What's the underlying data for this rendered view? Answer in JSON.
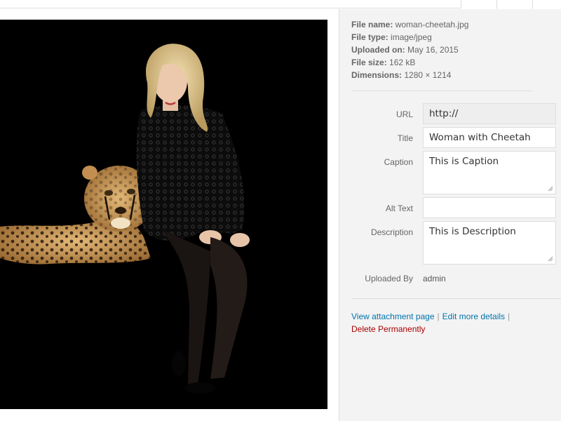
{
  "details": {
    "file_name_label": "File name:",
    "file_name": "woman-cheetah.jpg",
    "file_type_label": "File type:",
    "file_type": "image/jpeg",
    "uploaded_on_label": "Uploaded on:",
    "uploaded_on": "May 16, 2015",
    "file_size_label": "File size:",
    "file_size": "162 kB",
    "dimensions_label": "Dimensions:",
    "dimensions": "1280 × 1214"
  },
  "fields": {
    "url_label": "URL",
    "url_value": "http://",
    "title_label": "Title",
    "title_value": "Woman with Cheetah",
    "caption_label": "Caption",
    "caption_value": "This is Caption",
    "alt_label": "Alt Text",
    "alt_value": "",
    "description_label": "Description",
    "description_value": "This is Description",
    "uploaded_by_label": "Uploaded By",
    "uploaded_by_value": "admin"
  },
  "actions": {
    "view_attachment": "View attachment page",
    "edit_details": "Edit more details",
    "separator": "|",
    "delete": "Delete Permanently"
  },
  "colors": {
    "link": "#0073aa",
    "delete": "#aa0000",
    "sidebar_bg": "#f3f3f3"
  }
}
